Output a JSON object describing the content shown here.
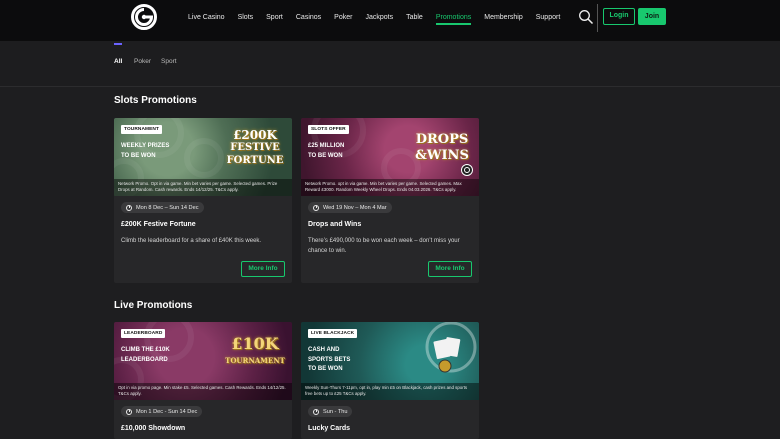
{
  "nav": {
    "items": [
      {
        "label": "Live Casino",
        "active": false
      },
      {
        "label": "Slots",
        "active": false
      },
      {
        "label": "Sport",
        "active": false
      },
      {
        "label": "Casinos",
        "active": false
      },
      {
        "label": "Poker",
        "active": false
      },
      {
        "label": "Jackpots",
        "active": false
      },
      {
        "label": "Table",
        "active": false
      },
      {
        "label": "Promotions",
        "active": true
      },
      {
        "label": "Membership",
        "active": false
      },
      {
        "label": "Support",
        "active": false
      }
    ],
    "login_label": "Login",
    "join_label": "Join"
  },
  "filters": {
    "tabs": [
      {
        "label": "All",
        "active": true
      },
      {
        "label": "Poker",
        "active": false
      },
      {
        "label": "Sport",
        "active": false
      }
    ]
  },
  "sections": {
    "slots": {
      "title": "Slots Promotions",
      "cards": [
        {
          "badge": "TOURNAMENT",
          "promo_line1": "WEEKLY PRIZES",
          "promo_line2": "TO BE WON",
          "art_line1": "£200K",
          "art_line2": "FESTIVE",
          "art_line3": "FORTUNE",
          "terms": "Network Promo. Opt in via game. Min bet varies per game. Selected games. Prize Drops at Random. Cash rewards. Ends 14/12/25. T&Cs apply.",
          "dates": "Mon 8 Dec – Sun 14 Dec",
          "title": "£200K Festive Fortune",
          "description": "Climb the leaderboard for a share of £40K this week.",
          "button": "More Info"
        },
        {
          "badge": "SLOTS OFFER",
          "promo_line1": "£25 MILLION",
          "promo_line2": "TO BE WON",
          "art_line1": "DROPS",
          "art_line2": "&WINS",
          "art_line3": "",
          "terms": "Network Promo. opt in via game. Min bet varies per game. Selected games. Max Reward £3000. Random Weekly Wheel Drops. Ends 04.03.2026. T&Cs apply.",
          "dates": "Wed 19 Nov – Mon 4 Mar",
          "title": "Drops and Wins",
          "description": "There’s £490,000 to be won each week – don’t miss your chance to win.",
          "button": "More Info"
        }
      ]
    },
    "live": {
      "title": "Live Promotions",
      "cards": [
        {
          "badge": "LEADERBOARD",
          "promo_line1": "CLIMB THE £10K",
          "promo_line2": "LEADERBOARD",
          "promo_line3": "",
          "art_line1": "£10K",
          "art_line2": "TOURNAMENT",
          "terms": "Opt in via promo page. Min stake £5. Selected games. Cash Rewards. Ends 14/12/25. T&Cs apply.",
          "dates": "Mon 1 Dec - Sun 14 Dec",
          "title": "£10,000 Showdown"
        },
        {
          "badge": "LIVE BLACKJACK",
          "promo_line1": "CASH AND",
          "promo_line2": "SPORTS BETS",
          "promo_line3": "TO BE WON",
          "terms": "Weekly Sun-Thurs 7-11pm, opt in, play min £5 on Blackjack, cash prizes and sports free bets up to £25 T&Cs apply.",
          "dates": "Sun - Thu",
          "title": "Lucky Cards"
        }
      ]
    }
  },
  "colors": {
    "accent": "#18c86e",
    "tab_indicator": "#6b63ff",
    "background": "#1e1e20",
    "card": "#272729"
  }
}
